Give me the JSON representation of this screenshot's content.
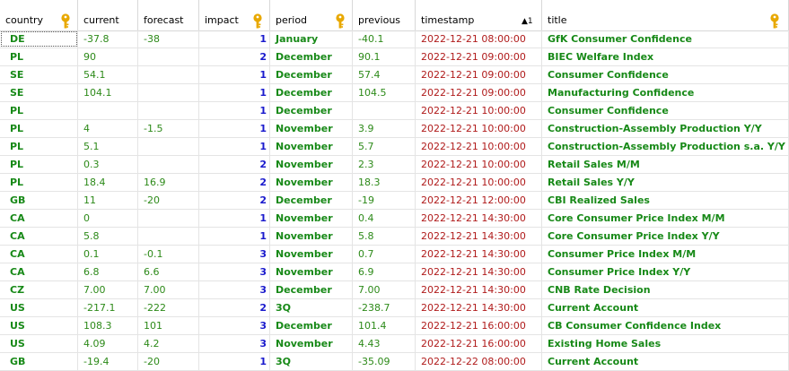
{
  "columns": [
    {
      "key": "country",
      "label": "country",
      "has_key_icon": true,
      "sort": ""
    },
    {
      "key": "current",
      "label": "current",
      "has_key_icon": false,
      "sort": ""
    },
    {
      "key": "forecast",
      "label": "forecast",
      "has_key_icon": false,
      "sort": ""
    },
    {
      "key": "impact",
      "label": "impact",
      "has_key_icon": true,
      "sort": ""
    },
    {
      "key": "period",
      "label": "period",
      "has_key_icon": true,
      "sort": ""
    },
    {
      "key": "previous",
      "label": "previous",
      "has_key_icon": false,
      "sort": ""
    },
    {
      "key": "timestamp",
      "label": "timestamp",
      "has_key_icon": false,
      "sort": "▲1"
    },
    {
      "key": "title",
      "label": "title",
      "has_key_icon": true,
      "sort": ""
    }
  ],
  "rows": [
    {
      "country": "DE",
      "current": "-37.8",
      "forecast": "-38",
      "impact": "1",
      "period": "January",
      "previous": "-40.1",
      "timestamp": "2022-12-21 08:00:00",
      "title": "GfK Consumer Confidence"
    },
    {
      "country": "PL",
      "current": "90",
      "forecast": "",
      "impact": "2",
      "period": "December",
      "previous": "90.1",
      "timestamp": "2022-12-21 09:00:00",
      "title": "BIEC Welfare Index"
    },
    {
      "country": "SE",
      "current": "54.1",
      "forecast": "",
      "impact": "1",
      "period": "December",
      "previous": "57.4",
      "timestamp": "2022-12-21 09:00:00",
      "title": "Consumer Confidence"
    },
    {
      "country": "SE",
      "current": "104.1",
      "forecast": "",
      "impact": "1",
      "period": "December",
      "previous": "104.5",
      "timestamp": "2022-12-21 09:00:00",
      "title": "Manufacturing Confidence"
    },
    {
      "country": "PL",
      "current": "",
      "forecast": "",
      "impact": "1",
      "period": "December",
      "previous": "",
      "timestamp": "2022-12-21 10:00:00",
      "title": "Consumer Confidence"
    },
    {
      "country": "PL",
      "current": "4",
      "forecast": "-1.5",
      "impact": "1",
      "period": "November",
      "previous": "3.9",
      "timestamp": "2022-12-21 10:00:00",
      "title": "Construction-Assembly Production Y/Y"
    },
    {
      "country": "PL",
      "current": "5.1",
      "forecast": "",
      "impact": "1",
      "period": "November",
      "previous": "5.7",
      "timestamp": "2022-12-21 10:00:00",
      "title": "Construction-Assembly Production s.a. Y/Y"
    },
    {
      "country": "PL",
      "current": "0.3",
      "forecast": "",
      "impact": "2",
      "period": "November",
      "previous": "2.3",
      "timestamp": "2022-12-21 10:00:00",
      "title": "Retail Sales M/M"
    },
    {
      "country": "PL",
      "current": "18.4",
      "forecast": "16.9",
      "impact": "2",
      "period": "November",
      "previous": "18.3",
      "timestamp": "2022-12-21 10:00:00",
      "title": "Retail Sales Y/Y"
    },
    {
      "country": "GB",
      "current": "11",
      "forecast": "-20",
      "impact": "2",
      "period": "December",
      "previous": "-19",
      "timestamp": "2022-12-21 12:00:00",
      "title": "CBI Realized Sales"
    },
    {
      "country": "CA",
      "current": "0",
      "forecast": "",
      "impact": "1",
      "period": "November",
      "previous": "0.4",
      "timestamp": "2022-12-21 14:30:00",
      "title": "Core Consumer Price Index M/M"
    },
    {
      "country": "CA",
      "current": "5.8",
      "forecast": "",
      "impact": "1",
      "period": "November",
      "previous": "5.8",
      "timestamp": "2022-12-21 14:30:00",
      "title": "Core Consumer Price Index Y/Y"
    },
    {
      "country": "CA",
      "current": "0.1",
      "forecast": "-0.1",
      "impact": "3",
      "period": "November",
      "previous": "0.7",
      "timestamp": "2022-12-21 14:30:00",
      "title": "Consumer Price Index M/M"
    },
    {
      "country": "CA",
      "current": "6.8",
      "forecast": "6.6",
      "impact": "3",
      "period": "November",
      "previous": "6.9",
      "timestamp": "2022-12-21 14:30:00",
      "title": "Consumer Price Index Y/Y"
    },
    {
      "country": "CZ",
      "current": "7.00",
      "forecast": "7.00",
      "impact": "3",
      "period": "December",
      "previous": "7.00",
      "timestamp": "2022-12-21 14:30:00",
      "title": "CNB Rate Decision"
    },
    {
      "country": "US",
      "current": "-217.1",
      "forecast": "-222",
      "impact": "2",
      "period": "3Q",
      "previous": "-238.7",
      "timestamp": "2022-12-21 14:30:00",
      "title": "Current Account"
    },
    {
      "country": "US",
      "current": "108.3",
      "forecast": "101",
      "impact": "3",
      "period": "December",
      "previous": "101.4",
      "timestamp": "2022-12-21 16:00:00",
      "title": "CB Consumer Confidence Index"
    },
    {
      "country": "US",
      "current": "4.09",
      "forecast": "4.2",
      "impact": "3",
      "period": "November",
      "previous": "4.43",
      "timestamp": "2022-12-21 16:00:00",
      "title": "Existing Home Sales"
    },
    {
      "country": "GB",
      "current": "-19.4",
      "forecast": "-20",
      "impact": "1",
      "period": "3Q",
      "previous": "-35.09",
      "timestamp": "2022-12-22 08:00:00",
      "title": "Current Account"
    }
  ],
  "selected_row": 0,
  "colors": {
    "country": "#178917",
    "numbers": "#2d8a19",
    "impact": "#1a1acd",
    "period": "#178917",
    "timestamp": "#b01b1b",
    "title": "#178917",
    "key_icon": "#e8a800"
  }
}
